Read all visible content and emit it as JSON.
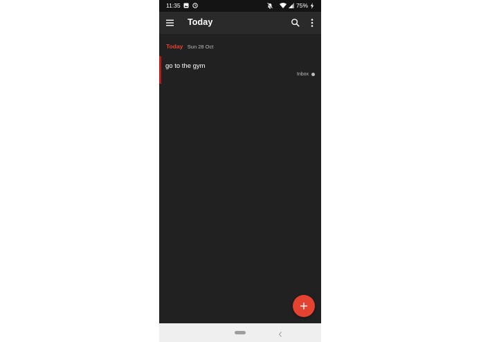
{
  "status_bar": {
    "time": "11:35",
    "battery": "75%",
    "icons": [
      "image-icon",
      "clock-icon",
      "bell-off-icon",
      "wifi-icon",
      "signal-icon",
      "charging-icon"
    ]
  },
  "app_bar": {
    "title": "Today",
    "icons": [
      "menu-icon",
      "search-icon",
      "more-vert-icon"
    ]
  },
  "section": {
    "label": "Today",
    "date": "Sun 28 Oct"
  },
  "tasks": [
    {
      "text": "go to the gym",
      "project": "Inbox"
    }
  ],
  "fab": {
    "icon": "plus-icon"
  },
  "navigation_bar": {
    "icons": [
      "home-pill-icon",
      "back-icon"
    ]
  },
  "colors": {
    "background": "#212121",
    "app_bar": "#2a2a2a",
    "status_bar": "#141414",
    "accent": "#e44332",
    "priority": "#b71c1c",
    "nav_bar": "#efefef"
  }
}
